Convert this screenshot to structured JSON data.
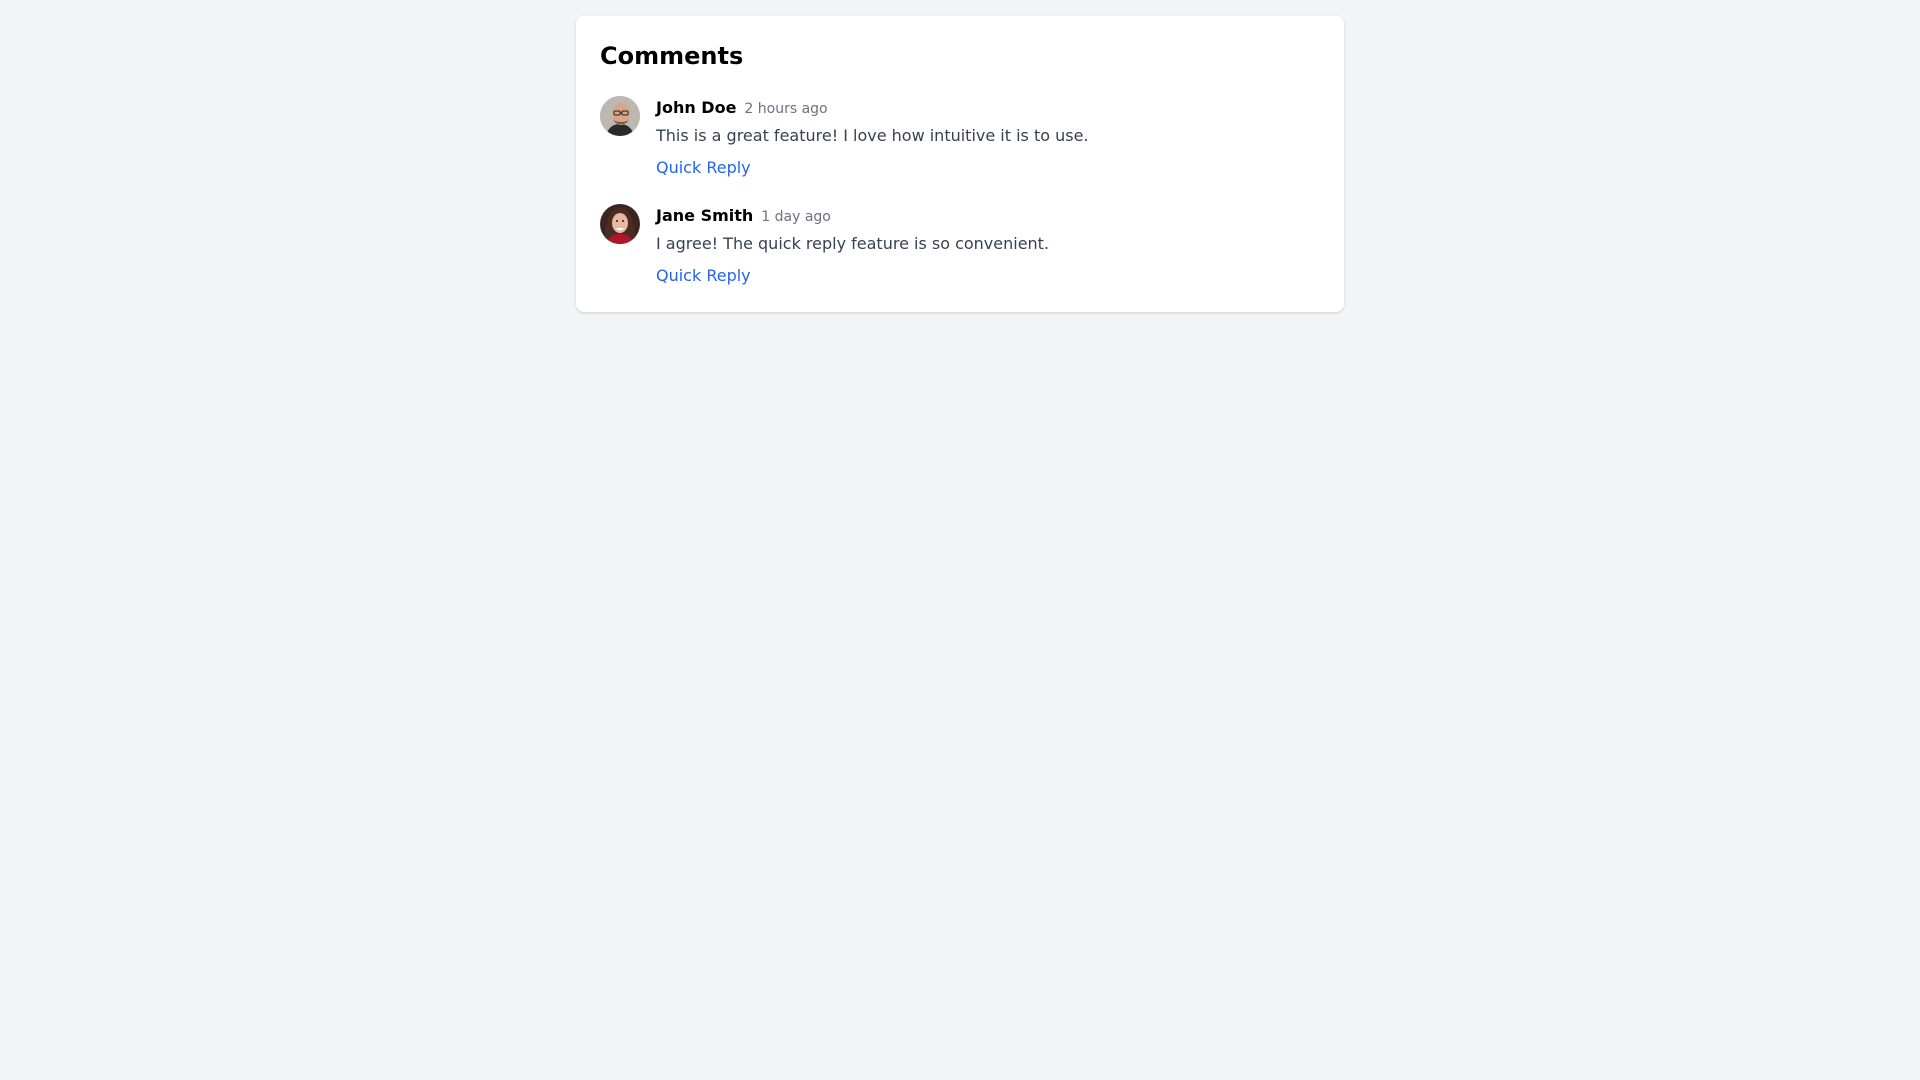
{
  "panel": {
    "title": "Comments"
  },
  "comments": [
    {
      "author": "John Doe",
      "timestamp": "2 hours ago",
      "text": "This is a great feature! I love how intuitive it is to use.",
      "reply_label": "Quick Reply"
    },
    {
      "author": "Jane Smith",
      "timestamp": "1 day ago",
      "text": "I agree! The quick reply feature is so convenient.",
      "reply_label": "Quick Reply"
    }
  ],
  "colors": {
    "page_background": "#f3f4f6",
    "card_background": "#ffffff",
    "timestamp": "#6b7280",
    "body_text": "#374151",
    "link": "#2563eb"
  }
}
